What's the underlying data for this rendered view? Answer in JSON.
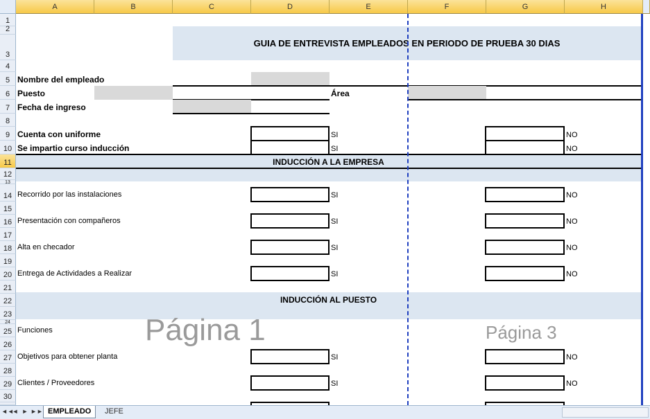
{
  "sheet": {
    "columns": [
      "A",
      "B",
      "C",
      "D",
      "E",
      "F",
      "G",
      "H"
    ],
    "rows": [
      "1",
      "2",
      "3",
      "4",
      "5",
      "6",
      "7",
      "8",
      "9",
      "10",
      "11",
      "12",
      "13",
      "14",
      "15",
      "16",
      "17",
      "18",
      "19",
      "20",
      "21",
      "22",
      "23",
      "24",
      "25",
      "26",
      "27",
      "28",
      "29",
      "30"
    ],
    "active_row": "11"
  },
  "title": "GUIA DE ENTREVISTA EMPLEADOS EN PERIODO DE PRUEBA 30 DIAS",
  "header_fields": {
    "employee_name": "Nombre del empleado",
    "position": "Puesto",
    "area": "Área",
    "start_date": "Fecha de ingreso",
    "uniform": "Cuenta con uniforme",
    "induction_course": "Se impartio curso inducción"
  },
  "yes_label": "SI",
  "no_label": "NO",
  "section_company": "INDUCCIÓN A LA EMPRESA",
  "company_items": [
    "Recorrido por las instalaciones",
    "Presentación con compañeros",
    "Alta en checador",
    "Entrega de Actividades a Realizar"
  ],
  "section_job": "INDUCCIÓN AL PUESTO",
  "job_items": [
    "Funciones",
    "Objetivos para obtener planta",
    "Clientes / Proveedores"
  ],
  "watermarks": [
    "Página 1",
    "Página 3"
  ],
  "tabs": [
    "EMPLEADO",
    "JEFE"
  ],
  "nav_buttons": [
    "◄◄",
    "◄",
    "►",
    "►►"
  ],
  "colors": {
    "band": "#dce6f1",
    "page_break": "#1f3fbf",
    "header_active": "#f7c948"
  }
}
